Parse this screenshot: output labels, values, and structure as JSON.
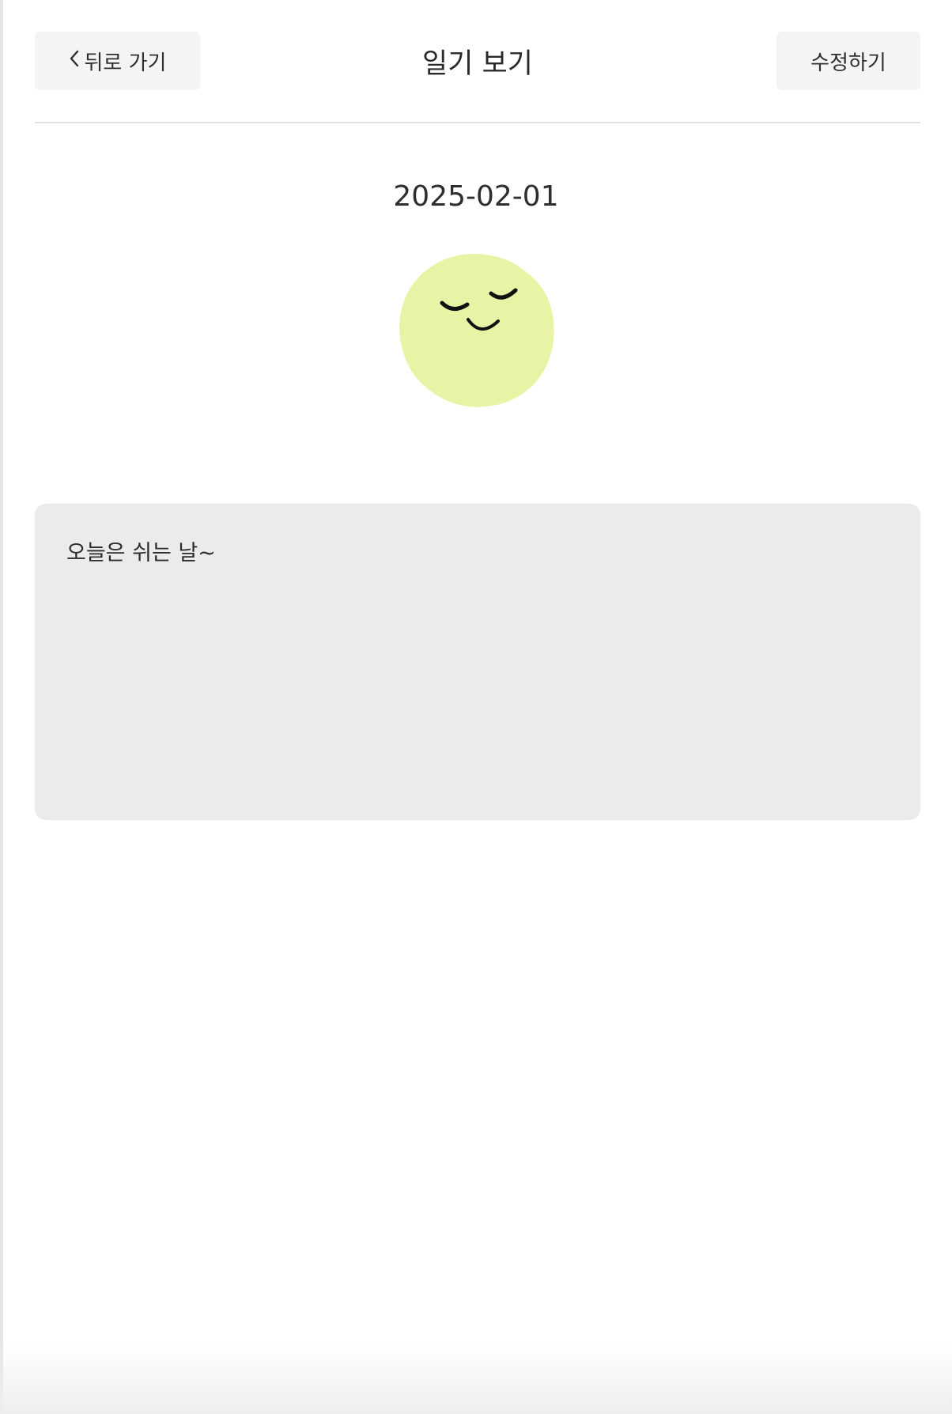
{
  "header": {
    "back_label": "뒤로 가기",
    "back_icon": "chevron-left-icon",
    "title": "일기 보기",
    "edit_label": "수정하기"
  },
  "diary": {
    "date": "2025-02-01",
    "emotion_icon": "peaceful-smile-face-icon",
    "emotion_color": "#e9f3a5",
    "content": "오늘은 쉬는 날~"
  },
  "colors": {
    "button_bg": "#f4f4f4",
    "content_bg": "#ebebeb",
    "divider": "#e1e1e1",
    "text": "#2b2b2b"
  }
}
